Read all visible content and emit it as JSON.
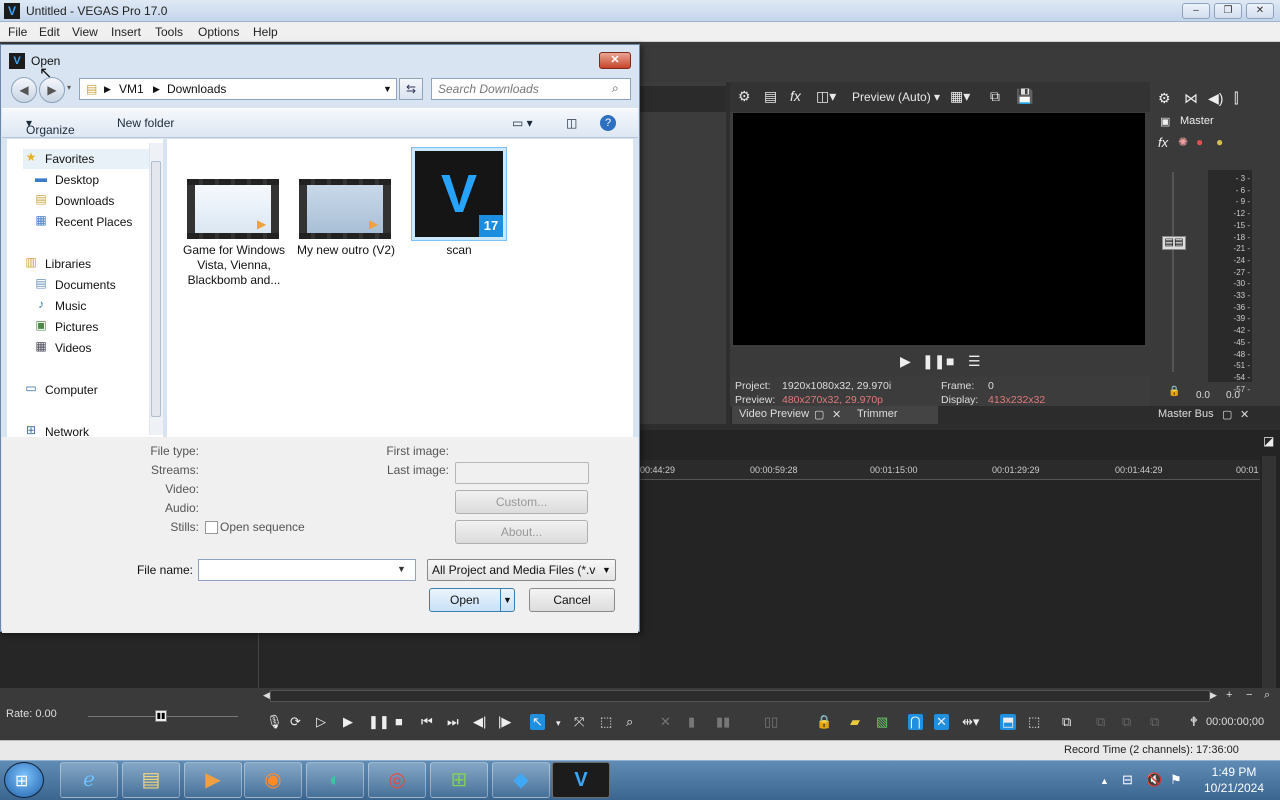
{
  "app": {
    "title": "Untitled - VEGAS Pro 17.0",
    "logo": "V",
    "window_controls": [
      "minimize-icon",
      "maximize-icon",
      "close-icon"
    ]
  },
  "menu": [
    "File",
    "Edit",
    "View",
    "Insert",
    "Tools",
    "Options",
    "Help"
  ],
  "preview": {
    "quality": "Preview (Auto)",
    "project_label": "Project:",
    "project_value": "1920x1080x32, 29.970i",
    "preview_label": "Preview:",
    "preview_value": "480x270x32, 29.970p",
    "frame_label": "Frame:",
    "frame_value": "0",
    "display_label": "Display:",
    "display_value": "413x232x32",
    "tabs": [
      "Video Preview",
      "Trimmer"
    ]
  },
  "master": {
    "label": "Master",
    "bus_tab": "Master Bus",
    "db_scale": [
      "- 3 -",
      "- 6 -",
      "- 9 -",
      "-12 -",
      "-15 -",
      "-18 -",
      "-21 -",
      "-24 -",
      "-27 -",
      "-30 -",
      "-33 -",
      "-36 -",
      "-39 -",
      "-42 -",
      "-45 -",
      "-48 -",
      "-51 -",
      "-54 -",
      "-57 -"
    ],
    "left_level": "0.0",
    "right_level": "0.0"
  },
  "timeline": {
    "ruler": [
      "00:44:29",
      "00:00:59:28",
      "00:01:15:00",
      "00:01:29:29",
      "00:01:44:29",
      "00:01"
    ],
    "rate": "Rate: 0.00",
    "timecode": "00:00:00;00",
    "record_time": "Record Time (2 channels): 17:36:00"
  },
  "dialog": {
    "title": "Open",
    "breadcrumb": [
      "VM1",
      "Downloads"
    ],
    "search_placeholder": "Search Downloads",
    "organize": "Organize",
    "new_folder": "New folder",
    "nav": {
      "favorites": "Favorites",
      "desktop": "Desktop",
      "downloads": "Downloads",
      "recent": "Recent Places",
      "libraries": "Libraries",
      "documents": "Documents",
      "music": "Music",
      "pictures": "Pictures",
      "videos": "Videos",
      "computer": "Computer",
      "network": "Network"
    },
    "files": [
      {
        "name": "Game for Windows Vista, Vienna, Blackbomb and..."
      },
      {
        "name": "My new outro (V2)"
      },
      {
        "name": "scan"
      }
    ],
    "scan_badge": "17",
    "details": {
      "file_type": "File type:",
      "streams": "Streams:",
      "video": "Video:",
      "audio": "Audio:",
      "stills": "Stills:",
      "open_sequence": "Open sequence",
      "first_image": "First image:",
      "last_image": "Last image:",
      "custom": "Custom...",
      "about": "About..."
    },
    "file_name_label": "File name:",
    "file_name_value": "",
    "file_type_filter": "All Project and Media Files (*.ve",
    "open_button": "Open",
    "cancel_button": "Cancel"
  },
  "taskbar": {
    "time": "1:49 PM",
    "date": "10/21/2024"
  }
}
